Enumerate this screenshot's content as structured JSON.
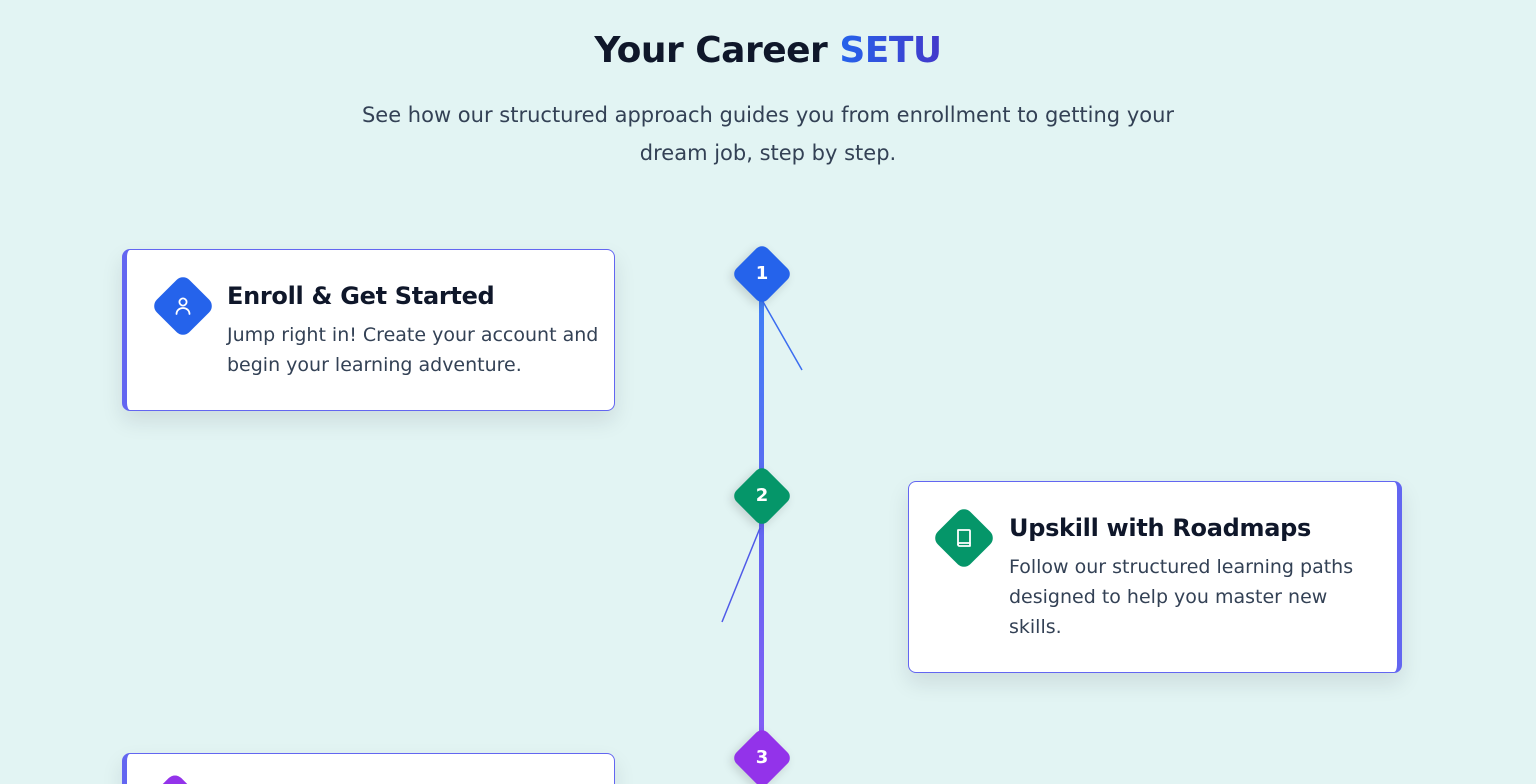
{
  "hero": {
    "title_main": "Your Career ",
    "title_accent": "SETU",
    "subtitle": "See how our structured approach guides you from enrollment to getting your dream job, step by step."
  },
  "steps": [
    {
      "number": "1",
      "title": "Enroll & Get Started",
      "description": "Jump right in! Create your account and begin your learning adventure.",
      "icon": "user-icon",
      "color": "#2563eb",
      "side": "left"
    },
    {
      "number": "2",
      "title": "Upskill with Roadmaps",
      "description": "Follow our structured learning paths designed to help you master new skills.",
      "icon": "book-icon",
      "color": "#059669",
      "side": "right"
    },
    {
      "number": "3",
      "title": "",
      "description": "",
      "icon": "",
      "color": "#9333ea",
      "side": "left"
    }
  ],
  "colors": {
    "background": "#e2f4f3",
    "card_border": "#6366f1",
    "timeline_top": "#3b82f6",
    "timeline_bottom": "#8b5cf6"
  }
}
